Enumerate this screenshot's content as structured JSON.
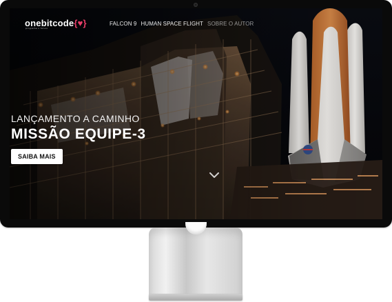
{
  "brand": {
    "logo_main": "onebitcode",
    "logo_accent": "{♥}",
    "tagline": "programe o futuro"
  },
  "nav": {
    "items": [
      {
        "label": "FALCON 9"
      },
      {
        "label": "HUMAN SPACE FLIGHT"
      },
      {
        "label": "SOBRE O AUTOR"
      }
    ]
  },
  "hero": {
    "eyebrow": "LANÇAMENTO A CAMINHO",
    "headline": "MISSÃO EQUIPE-3",
    "cta_label": "SAIBA MAIS"
  },
  "colors": {
    "accent": "#e83d68"
  },
  "icons": {
    "scroll_chevron": "chevron-down-icon"
  }
}
